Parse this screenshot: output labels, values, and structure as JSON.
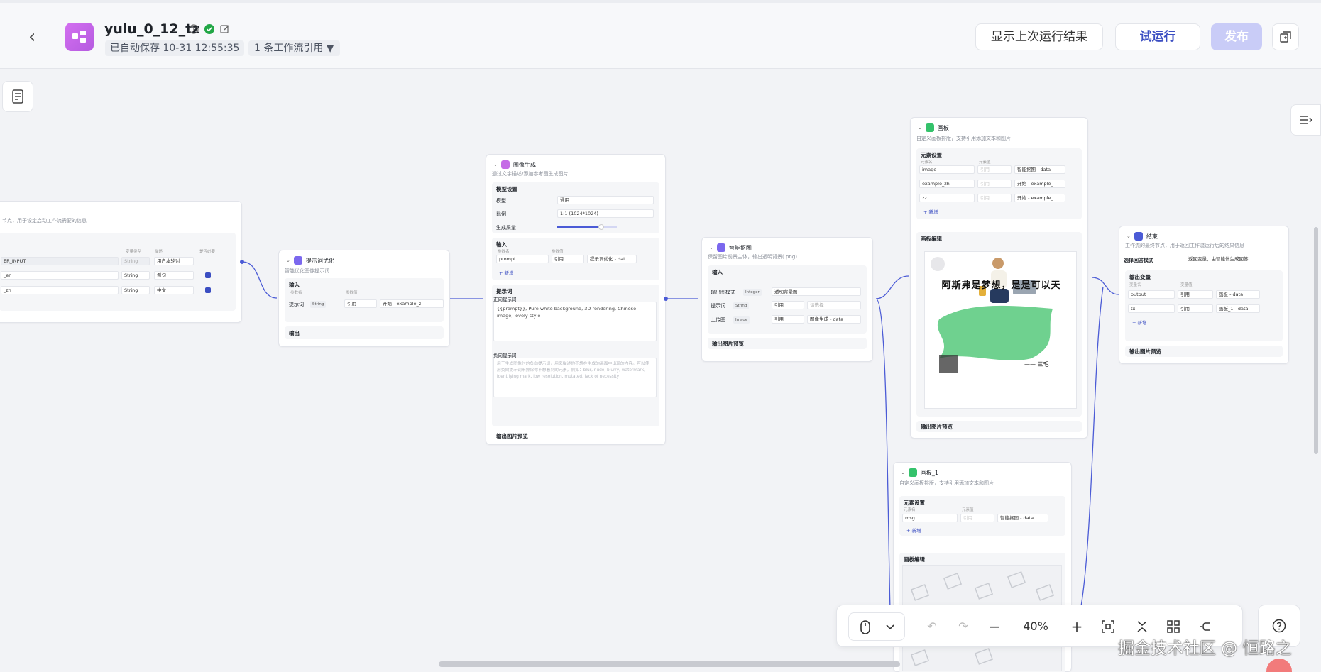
{
  "header": {
    "title": "yulu_0_12_tz",
    "autosave": "已自动保存 10-31 12:55:35",
    "refs": "1 条工作流引用 ▼",
    "show_last": "显示上次运行结果",
    "trial": "试运行",
    "publish": "发布"
  },
  "colors": {
    "accent": "#3b4ec2",
    "app_icon": "#d36ff0",
    "success": "#22a746",
    "publish_disabled": "#c9ccf7"
  },
  "start": {
    "desc": "节点，用于设定启动工作流需要的信息",
    "rows": [
      {
        "name": "ER_INPUT",
        "type": "String",
        "val": "用户本轮对"
      },
      {
        "name": "_en",
        "type": "String",
        "val": "例句"
      },
      {
        "name": "_zh",
        "type": "String",
        "val": "中文"
      }
    ]
  },
  "prompt_opt": {
    "title": "提示词优化",
    "desc": "智能优化图像提示词",
    "input_label": "输入",
    "col1": "参数名",
    "col2": "参数值",
    "p_name": "提示词",
    "p_type": "String",
    "p_ref": "引用",
    "p_val": "开始 - example_z",
    "output_label": "输出"
  },
  "imggen": {
    "title": "图像生成",
    "desc": "通过文字描述/添加参考图生成图片",
    "model_sec": "模型设置",
    "model_label": "模型",
    "model_val": "通用",
    "ratio_label": "比例",
    "ratio_val": "1:1 (1024*1024)",
    "quality_label": "生成质量",
    "input_label": "输入",
    "col1": "参数名",
    "col2": "参数值",
    "p_name": "prompt",
    "p_ref": "引用",
    "p_val": "提示词优化 - dat",
    "add": "+ 新增",
    "prompt_sec": "提示词",
    "pos_label": "正向提示词",
    "pos_text": "{{prompt}}, Pure white background, 3D rendering, Chinese image, lovely style",
    "neg_label": "负向提示词",
    "neg_text": "用于生成图像时的负向提示词，用来描述你不想在生成的画面中出现的内容。可以使用负向提示词来排除你不想看到的元素，例如：blur, nude, blurry, watermark, identifying mark, low resolution, mutated, lack of necessity",
    "preview": "输出图片预览"
  },
  "matting": {
    "title": "智能抠图",
    "desc": "保留图片前景主体，输出透明背景(.png)",
    "input_label": "输入",
    "mode_label": "输出图模式",
    "mode_type": "Integer",
    "mode_val": "透明背景图",
    "p1_name": "提示词",
    "p1_type": "String",
    "p1_ref": "引用",
    "p1_val": "请选择",
    "p2_name": "上传图",
    "p2_type": "Image",
    "p2_ref": "引用",
    "p2_val": "图像生成 - data",
    "preview": "输出图片预览"
  },
  "canvas1": {
    "title": "画板",
    "desc": "自定义画板排版，支持引用添加文本和图片",
    "elem_sec": "元素设置",
    "col1": "元素名",
    "col2": "元素值",
    "rows": [
      {
        "name": "image",
        "ref": "引用",
        "val": "智能抠图 - data"
      },
      {
        "name": "example_zh",
        "ref": "引用",
        "val": "开始 - example_"
      },
      {
        "name": "zz",
        "ref": "引用",
        "val": "开始 - example_"
      }
    ],
    "add": "+ 新增",
    "edit_sec": "画板编辑",
    "poster_text": "阿斯弗是梦想，是是可以天",
    "poster_sign": "—— 三毛",
    "preview": "输出图片预览"
  },
  "canvas2": {
    "title": "画板_1",
    "desc": "自定义画板排版，支持引用添加文本和图片",
    "elem_sec": "元素设置",
    "col1": "元素名",
    "col2": "元素值",
    "row_name": "msg",
    "row_ref": "引用",
    "row_val": "智能抠图 - data",
    "add": "+ 新增",
    "edit_sec": "画板编辑"
  },
  "end": {
    "title": "结束",
    "desc": "工作流的最终节点，用于返回工作流运行后的结果信息",
    "mode_label": "选择回答模式",
    "mode_val": "返回变量，由智能体生成回答",
    "out_sec": "输出变量",
    "col1": "变量名",
    "col2": "变量值",
    "rows": [
      {
        "name": "output",
        "ref": "引用",
        "val": "画板 - data"
      },
      {
        "name": "tx",
        "ref": "引用",
        "val": "画板_1 - data"
      }
    ],
    "add": "+ 新增",
    "preview": "输出图片预览"
  },
  "toolbar": {
    "zoom": "40%"
  },
  "watermark": "掘金技术社区 @ 恒路之"
}
